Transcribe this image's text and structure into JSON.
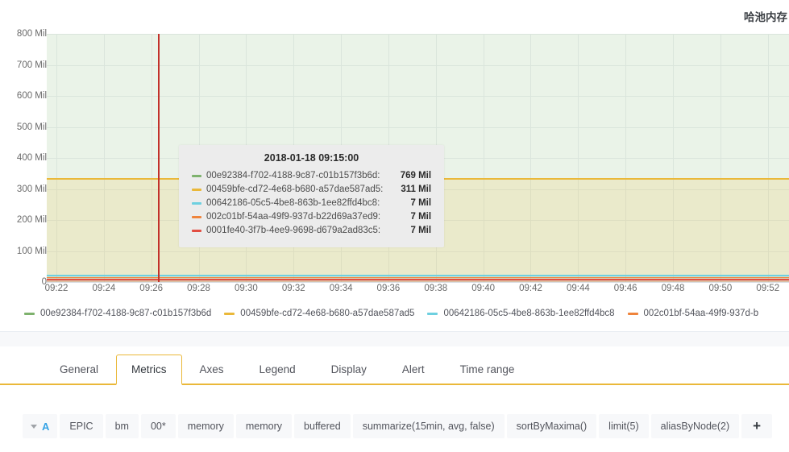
{
  "panel": {
    "title": "哈池内存",
    "kind_label": "Graph"
  },
  "chart_data": {
    "type": "area",
    "stacked": true,
    "title": "哈池内存",
    "xlabel": "",
    "ylabel": "",
    "ylim": [
      0,
      800
    ],
    "yunit": "Mil",
    "grid": true,
    "legend_position": "bottom",
    "ytick_labels": [
      "800 Mil",
      "700 Mil",
      "600 Mil",
      "500 Mil",
      "400 Mil",
      "300 Mil",
      "200 Mil",
      "100 Mil",
      "0"
    ],
    "ytick_values": [
      800,
      700,
      600,
      500,
      400,
      300,
      200,
      100,
      0
    ],
    "xtick_labels": [
      "09:22",
      "09:24",
      "09:26",
      "09:28",
      "09:30",
      "09:32",
      "09:34",
      "09:36",
      "09:38",
      "09:40",
      "09:42",
      "09:44",
      "09:46",
      "09:48",
      "09:50",
      "09:52"
    ],
    "crosshair_x_label": "09:15:00",
    "series": [
      {
        "name": "00e92384-f702-4188-9c87-c01b157f3b6d",
        "color": "#7eb26d",
        "value_at_cursor": 769,
        "value_label": "769 Mil"
      },
      {
        "name": "00459bfe-cd72-4e68-b680-a57dae587ad5",
        "color": "#eab839",
        "value_at_cursor": 311,
        "value_label": "311 Mil"
      },
      {
        "name": "00642186-05c5-4be8-863b-1ee82ffd4bc8",
        "color": "#6ed0e0",
        "value_at_cursor": 7,
        "value_label": "7 Mil"
      },
      {
        "name": "002c01bf-54aa-49f9-937d-b22d69a37ed9",
        "color": "#ef843c",
        "value_at_cursor": 7,
        "value_label": "7 Mil"
      },
      {
        "name": "0001fe40-3f7b-4ee9-9698-d679a2ad83c5",
        "color": "#e24d42",
        "value_at_cursor": 7,
        "value_label": "7 Mil"
      }
    ]
  },
  "tooltip": {
    "time": "2018-01-18 09:15:00",
    "rows": [
      {
        "color": "#7eb26d",
        "label": "00e92384-f702-4188-9c87-c01b157f3b6d:",
        "value": "769 Mil"
      },
      {
        "color": "#eab839",
        "label": "00459bfe-cd72-4e68-b680-a57dae587ad5:",
        "value": "311 Mil"
      },
      {
        "color": "#6ed0e0",
        "label": "00642186-05c5-4be8-863b-1ee82ffd4bc8:",
        "value": "7 Mil"
      },
      {
        "color": "#ef843c",
        "label": "002c01bf-54aa-49f9-937d-b22d69a37ed9:",
        "value": "7 Mil"
      },
      {
        "color": "#e24d42",
        "label": "0001fe40-3f7b-4ee9-9698-d679a2ad83c5:",
        "value": "7 Mil"
      }
    ]
  },
  "legend": {
    "items": [
      {
        "color": "#7eb26d",
        "label": "00e92384-f702-4188-9c87-c01b157f3b6d"
      },
      {
        "color": "#eab839",
        "label": "00459bfe-cd72-4e68-b680-a57dae587ad5"
      },
      {
        "color": "#6ed0e0",
        "label": "00642186-05c5-4be8-863b-1ee82ffd4bc8"
      },
      {
        "color": "#ef843c",
        "label": "002c01bf-54aa-49f9-937d-b"
      }
    ]
  },
  "editor": {
    "tabs": [
      {
        "label": "General",
        "active": false
      },
      {
        "label": "Metrics",
        "active": true
      },
      {
        "label": "Axes",
        "active": false
      },
      {
        "label": "Legend",
        "active": false
      },
      {
        "label": "Display",
        "active": false
      },
      {
        "label": "Alert",
        "active": false
      },
      {
        "label": "Time range",
        "active": false
      }
    ],
    "query": {
      "ref_id": "A",
      "segments": [
        "EPIC",
        "bm",
        "00*",
        "memory",
        "memory",
        "buffered",
        "summarize(15min, avg, false)",
        "sortByMaxima()",
        "limit(5)",
        "aliasByNode(2)"
      ],
      "add_label": "+"
    }
  },
  "colors": {
    "accent": "#eab839",
    "ref_id": "#33a2e5",
    "crosshair": "#c2302a"
  }
}
